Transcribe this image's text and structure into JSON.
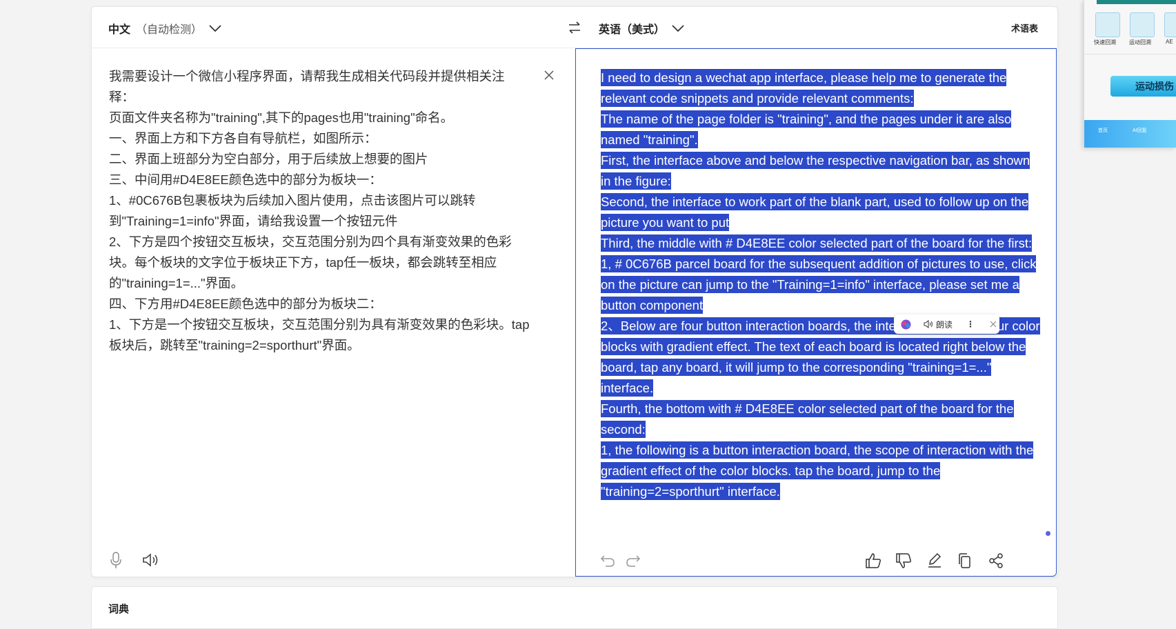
{
  "lang_bar": {
    "source_lang": "中文",
    "source_detect": "（自动检测）",
    "target_lang": "英语（美式）",
    "glossary": "术语表"
  },
  "source": {
    "text": "我需要设计一个微信小程序界面，请帮我生成相关代码段并提供相关注释：\n页面文件夹名称为\"training\",其下的pages也用\"training\"命名。\n一、界面上方和下方各自有导航栏，如图所示：\n二、界面上班部分为空白部分，用于后续放上想要的图片\n三、中间用#D4E8EE颜色选中的部分为板块一：\n1、#0C676B包裹板块为后续加入图片使用，点击该图片可以跳转到\"Training=1=info\"界面，请给我设置一个按钮元件\n2、下方是四个按钮交互板块，交互范围分别为四个具有渐变效果的色彩块。每个板块的文字位于板块正下方，tap任一板块，都会跳转至相应的\"training=1=...\"界面。\n四、下方用#D4E8EE颜色选中的部分为板块二：\n1、下方是一个按钮交互板块，交互范围分别为具有渐变效果的色彩块。tap板块后，跳转至\"training=2=sporthurt\"界面。"
  },
  "target": {
    "lines": [
      "I need to design a wechat app interface, please help me to generate the relevant code snippets and provide relevant comments:",
      "The name of the page folder is \"training\", and the pages under it are also named \"training\".",
      "First, the interface above and below the respective navigation bar, as shown in the figure:",
      "Second, the interface to work part of the blank part, used to follow up on the picture you want to put",
      "Third, the middle with # D4E8EE color selected part of the board for the first:",
      "1, # 0C676B parcel board for the subsequent addition of pictures to use, click on the picture can jump to the \"Training=1=info\" interface, please set me a button component",
      "2、Below are four button interaction boards, the interaction range is four color blocks with gradient effect. The text of each board is located right below the board, tap any board, it will jump to the corresponding \"training=1=...\" interface.",
      "Fourth, the bottom with # D4E8EE color selected part of the board for the second:",
      "1, the following is a button interaction board, the scope of interaction with the gradient effect of the color blocks. tap the board, jump to the \"training=2=sporthurt\" interface."
    ],
    "selection_color": "#2c49c9"
  },
  "popup": {
    "read_aloud": "朗读",
    "more": "⋮"
  },
  "dictionary": {
    "label": "词典"
  },
  "side_panel": {
    "icon_labels": [
      "快速回溯",
      "运动回溯",
      "AE"
    ],
    "button": "运动损伤",
    "nav": [
      "首页",
      "AI回复"
    ]
  },
  "colors": {
    "accent": "#2f57c7",
    "selection": "#2c49c9",
    "panel_teal": "#1d8a84"
  }
}
